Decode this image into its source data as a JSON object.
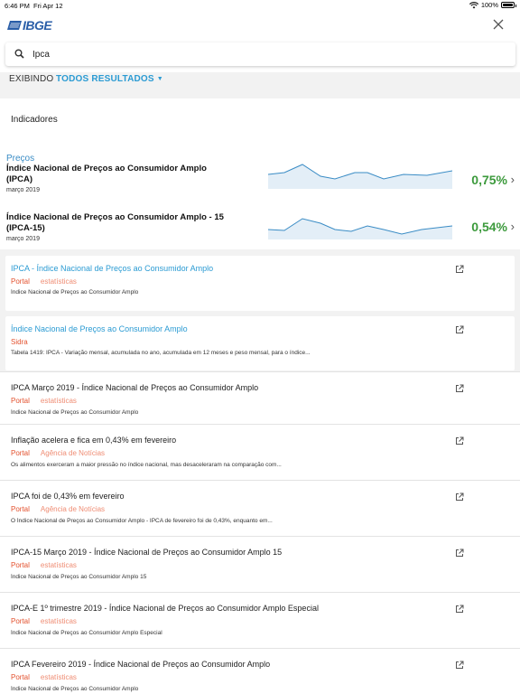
{
  "status_bar": {
    "time": "6:46 PM",
    "date": "Fri Apr 12",
    "battery": "100%"
  },
  "header": {
    "logo_text": "IBGE"
  },
  "search": {
    "value": "Ipca",
    "placeholder": ""
  },
  "filter": {
    "label": "EXIBINDO",
    "selected": "TODOS RESULTADOS"
  },
  "indicators": {
    "heading": "Indicadores",
    "category": "Preços",
    "items": [
      {
        "name": "Índice Nacional de Preços ao Consumidor Amplo (IPCA)",
        "date": "março 2019",
        "value": "0,75%"
      },
      {
        "name": "Índice Nacional de Preços ao Consumidor Amplo - 15 (IPCA-15)",
        "date": "março 2019",
        "value": "0,54%"
      }
    ]
  },
  "results": [
    {
      "title": "IPCA - Índice Nacional de Preços ao Consumidor Amplo",
      "source": "Portal",
      "type": "estatísticas",
      "desc": "Índice Nacional de Preços ao Consumidor Amplo"
    },
    {
      "title": "Índice Nacional de Preços ao Consumidor Amplo",
      "source": "Sidra",
      "type": "",
      "desc": "Tabela 1419: IPCA - Variação mensal, acumulada no ano, acumulada em 12 meses e peso mensal, para o índice..."
    },
    {
      "title": "IPCA Março 2019 - Índice Nacional de Preços ao Consumidor Amplo",
      "source": "Portal",
      "type": "estatísticas",
      "desc": "Índice Nacional de Preços ao Consumidor Amplo"
    },
    {
      "title": "Inflação acelera e fica em 0,43% em fevereiro",
      "source": "Portal",
      "type": "Agência de Notícias",
      "desc": "Os alimentos exerceram a maior pressão no índice nacional, mas desaceleraram na comparação com..."
    },
    {
      "title": "IPCA foi de 0,43% em fevereiro",
      "source": "Portal",
      "type": "Agência de Notícias",
      "desc": "O Índice Nacional de Preços ao Consumidor Amplo - IPCA de fevereiro foi de 0,43%, enquanto em..."
    },
    {
      "title": "IPCA-15 Março 2019 - Índice Nacional de Preços ao Consumidor Amplo 15",
      "source": "Portal",
      "type": "estatísticas",
      "desc": "Índice Nacional de Preços ao Consumidor Amplo 15"
    },
    {
      "title": "IPCA-E 1º trimestre 2019 - Índice Nacional de Preços ao Consumidor Amplo Especial",
      "source": "Portal",
      "type": "estatísticas",
      "desc": "Índice Nacional de Preços ao Consumidor Amplo Especial"
    },
    {
      "title": "IPCA Fevereiro 2019 - Índice Nacional de Preços ao Consumidor Amplo",
      "source": "Portal",
      "type": "estatísticas",
      "desc": "Índice Nacional de Preços ao Consumidor Amplo"
    }
  ],
  "colors": {
    "accent": "#2b9bd3",
    "positive": "#3c9a3c",
    "source_tag": "#e3522f",
    "type_tag": "#ef8c73",
    "logo": "#2a5ea8"
  }
}
